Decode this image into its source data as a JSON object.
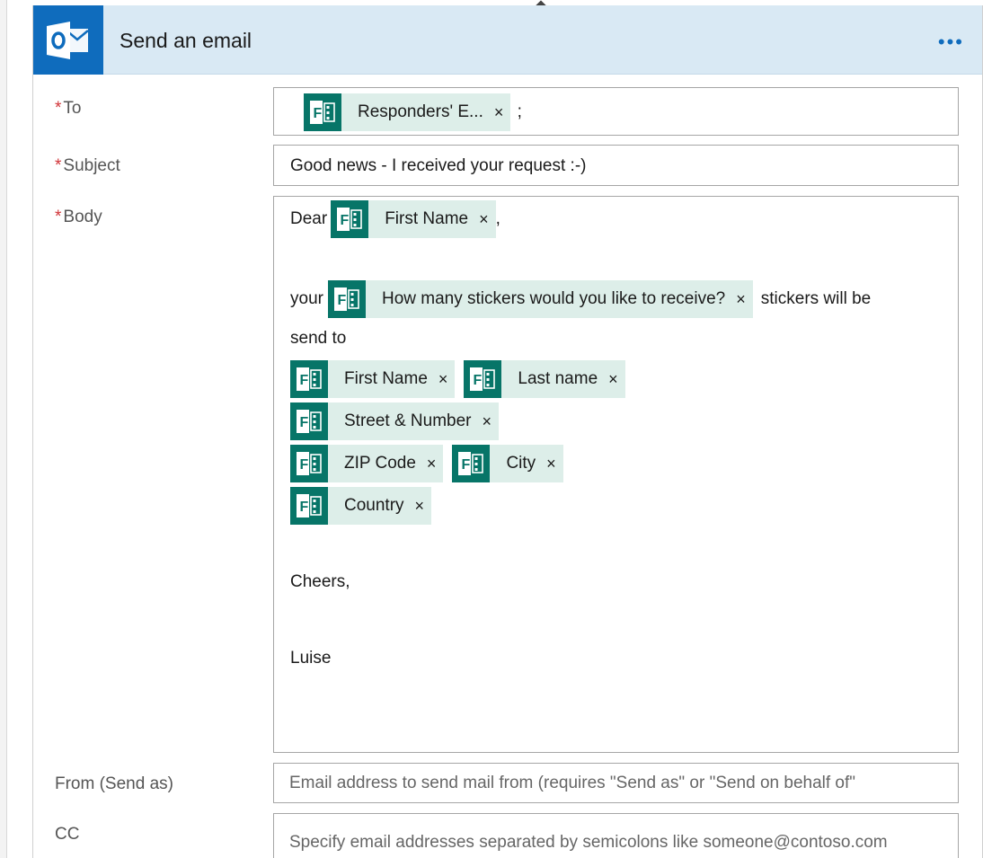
{
  "header": {
    "title": "Send an email",
    "more_label": "•••",
    "icon": "outlook-icon",
    "accent": "#0f6cbd",
    "header_bg": "#d9e9f4"
  },
  "token_color": "#077568",
  "token_bg": "#ddeee9",
  "required_marker": "*",
  "fields": {
    "to": {
      "label": "To",
      "tokens": [
        {
          "label": "Responders' E...",
          "remove": "×"
        }
      ],
      "suffix": ";"
    },
    "subject": {
      "label": "Subject",
      "value": "Good news - I received your request :-)"
    },
    "body": {
      "label": "Body",
      "dear": "Dear",
      "dear_suffix": ",",
      "your": "your",
      "stickers_text": "stickers will be",
      "send_to": "send to",
      "tokens": {
        "first_name_1": "First Name",
        "stickers_q": "How many stickers would you like to receive?",
        "first_name_2": "First Name",
        "last_name": "Last name",
        "street": "Street & Number",
        "zip": "ZIP Code",
        "city": "City",
        "country": "Country"
      },
      "remove": "×",
      "cheers": "Cheers,",
      "signature": "Luise"
    },
    "from": {
      "label": "From (Send as)",
      "placeholder": "Email address to send mail from (requires \"Send as\" or \"Send on behalf of\""
    },
    "cc": {
      "label": "CC",
      "placeholder": "Specify email addresses separated by semicolons like someone@contoso.com"
    }
  }
}
